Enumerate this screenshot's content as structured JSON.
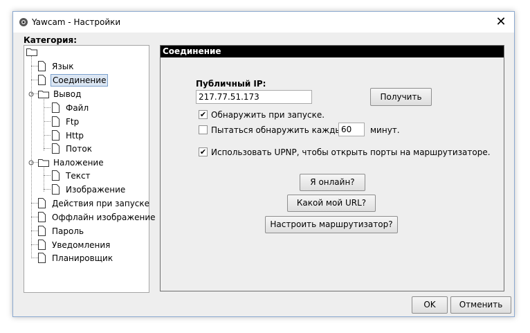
{
  "window": {
    "title": "Yawcam - Настройки",
    "close_glyph": "✕"
  },
  "category": {
    "label": "Категория:",
    "items": [
      {
        "label": "Язык"
      },
      {
        "label": "Соединение"
      },
      {
        "label": "Вывод"
      },
      {
        "label": "Файл"
      },
      {
        "label": "Ftp"
      },
      {
        "label": "Http"
      },
      {
        "label": "Поток"
      },
      {
        "label": "Наложение"
      },
      {
        "label": "Текст"
      },
      {
        "label": "Изображение"
      },
      {
        "label": "Действия при запуске"
      },
      {
        "label": "Оффлайн изображение"
      },
      {
        "label": "Пароль"
      },
      {
        "label": "Уведомления"
      },
      {
        "label": "Планировщик"
      }
    ]
  },
  "panel": {
    "title": "Соединение",
    "public_ip_label": "Публичный IP:",
    "public_ip_value": "217.77.51.173",
    "get_button": "Получить",
    "detect_on_start": {
      "label": "Обнаружить при запуске.",
      "checked": true
    },
    "try_detect": {
      "label_before": "Пытаться обнаружить каждые",
      "minutes": "60",
      "label_after": "минут.",
      "checked": false
    },
    "upnp": {
      "label": "Использовать UPNP, чтобы открыть порты на маршрутизаторе.",
      "checked": true
    },
    "online_button": "Я онлайн?",
    "url_button": "Какой мой URL?",
    "router_button": "Настроить маршрутизатор?"
  },
  "footer": {
    "ok": "OK",
    "cancel": "Отменить"
  },
  "colors": {
    "selection_bg": "#dbe6f3",
    "panel_header": "#000000"
  },
  "icons": {
    "check": "✔"
  }
}
